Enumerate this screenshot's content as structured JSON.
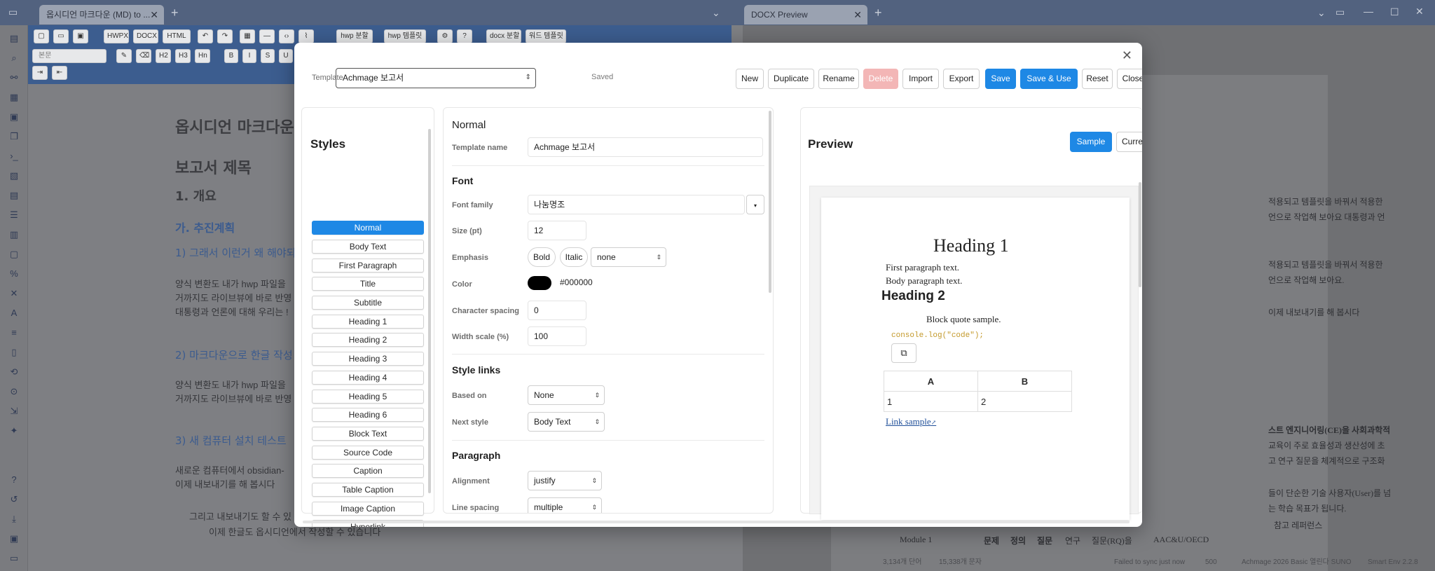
{
  "app": {
    "tabs": [
      {
        "label": "옵시디언 마크다운 (MD) to ...",
        "close": "✕"
      },
      {
        "label": "DOCX Preview",
        "close": "✕"
      }
    ],
    "ribbon": {
      "buttons": [
        "HWPX",
        "DOCX",
        "HTML",
        "hwp 분할",
        "hwp 템플릿",
        "docx 분할",
        "워드 템플릿"
      ],
      "para_select": "본문",
      "format_buttons": [
        "H2",
        "H3",
        "Hn",
        "B",
        "I",
        "S",
        "U"
      ]
    }
  },
  "editor": {
    "title": "옵시디언 마크다운",
    "h_report": "보고서 제목",
    "h_overview": "1. 개요",
    "h_plan": "가. 추진계획",
    "h_item1": "1) 그래서 이런거 왜 해야되",
    "para1_l1": "양식 변환도 내가 hwp 파일을",
    "para1_l2": "거까지도 라이브뷰에 바로 반영",
    "para1_l3": "대통령과 언론에 대해 우리는 !",
    "h_item2": "2) 마크다운으로 한글 작성",
    "para2_l1": "양식 변환도 내가 hwp 파일을",
    "para2_l2": "거까지도 라이브뷰에 바로 반영",
    "h_item3": "3)  새 컴퓨터 설치 테스트",
    "para3_l1": "새로운 컴퓨터에서 obsidian-",
    "para3_l2": "이제 내보내기를 해 봅시다",
    "bullet1": "그리고 내보내기도 할 수 있",
    "bullet2": "이제 한글도 옵시디언에서 작성할 수 있습니다"
  },
  "doc_bg": {
    "lines": [
      "적용되고 템플릿을 바꿔서 적용한",
      "언으로 작업해 보아요 대통령과 언",
      "적용되고 템플릿을 바꿔서 적용한",
      "언으로 작업해 보아요.",
      "이제 내보내기를 해 봅시다",
      "스트 엔지니어링(CE)을 사회과학적",
      "교육이 주로 효율성과 생산성에 초",
      "고 연구 질문을 체계적으로 구조화",
      "들이 단순한 기술 사용자(User)를 넘",
      "는 학습 목표가 됩니다.",
      "참고 레퍼런스",
      "Module 1",
      "문제",
      "정의",
      "질문",
      "연구",
      "질문(RQ)을",
      "AAC&U/OECD"
    ]
  },
  "status": {
    "words": "3,134개 단어",
    "chars": "15,338개 문자",
    "sync": "Failed to sync just now",
    "count": "500",
    "template": "Achmage 2026 Basic 열린다 SUNO",
    "env": "Smart Env 2.2.8"
  },
  "modal": {
    "close": "✕",
    "template_label": "Template",
    "template_value": "Achmage 보고서",
    "saved": "Saved",
    "buttons": {
      "new": "New",
      "duplicate": "Duplicate",
      "rename": "Rename",
      "delete": "Delete",
      "import": "Import",
      "export": "Export",
      "save": "Save",
      "save_use": "Save & Use",
      "reset": "Reset",
      "close": "Close"
    },
    "styles": {
      "title": "Styles",
      "items": [
        "Normal",
        "Body Text",
        "First Paragraph",
        "Title",
        "Subtitle",
        "Heading 1",
        "Heading 2",
        "Heading 3",
        "Heading 4",
        "Heading 5",
        "Heading 6",
        "Block Text",
        "Source Code",
        "Caption",
        "Table Caption",
        "Image Caption",
        "Hyperlink"
      ],
      "selected": "Normal"
    },
    "form": {
      "heading": "Normal",
      "template_name_label": "Template name",
      "template_name": "Achmage 보고서",
      "font_section": "Font",
      "font_family_label": "Font family",
      "font_family": "나눔명조",
      "size_label": "Size (pt)",
      "size": "12",
      "emphasis_label": "Emphasis",
      "bold": "Bold",
      "italic": "Italic",
      "emphasis_select": "none",
      "color_label": "Color",
      "color_value": "#000000",
      "char_spacing_label": "Character spacing",
      "char_spacing": "0",
      "width_scale_label": "Width scale (%)",
      "width_scale": "100",
      "style_links_section": "Style links",
      "based_on_label": "Based on",
      "based_on": "None",
      "next_style_label": "Next style",
      "next_style": "Body Text",
      "paragraph_section": "Paragraph",
      "alignment_label": "Alignment",
      "alignment": "justify",
      "line_spacing_label": "Line spacing",
      "line_spacing": "multiple"
    },
    "preview": {
      "title": "Preview",
      "sample": "Sample",
      "current": "Current",
      "heading1": "Heading 1",
      "first_para": "First paragraph text.",
      "body_para": "Body paragraph text.",
      "heading2": "Heading 2",
      "block_quote": "Block quote sample.",
      "code": "console.log(\"code\");",
      "table_headers": [
        "A",
        "B"
      ],
      "table_row": [
        "1",
        "2"
      ],
      "link": "Link sample"
    }
  },
  "colors": {
    "accent": "#1e88e5",
    "danger": "#f3b6b6"
  }
}
